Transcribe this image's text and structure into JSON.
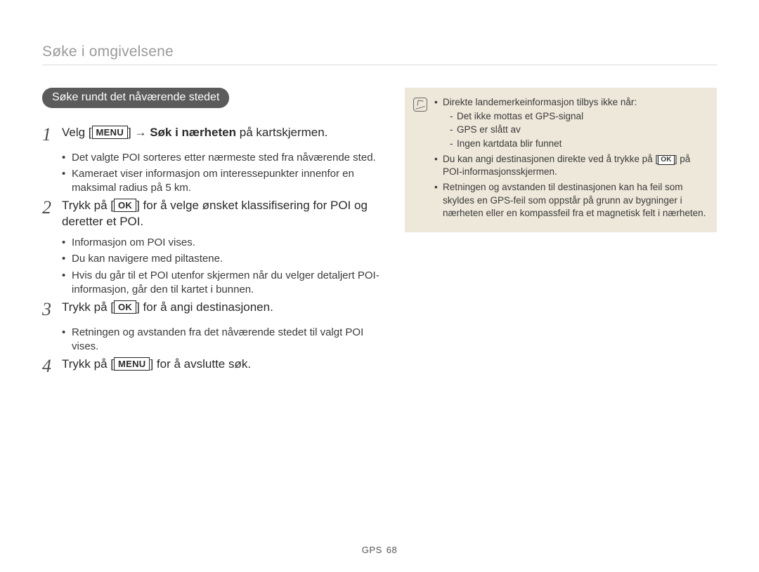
{
  "header": {
    "title": "Søke i omgivelsene"
  },
  "pill": {
    "label": "Søke rundt det nåværende stedet"
  },
  "buttons": {
    "menu": "MENU",
    "ok": "OK"
  },
  "steps": [
    {
      "num": "1",
      "parts": {
        "p1": "Velg [",
        "btn": "menu",
        "p2": "] → ",
        "bold": "Søk i nærheten",
        "p3": " på kartskjermen."
      },
      "bullets": [
        "Det valgte POI sorteres etter nærmeste sted fra nåværende sted.",
        "Kameraet viser informasjon om interessepunkter innenfor en maksimal radius på 5 km."
      ]
    },
    {
      "num": "2",
      "parts": {
        "p1": "Trykk på [",
        "btn": "ok",
        "p2": "] for å velge ønsket klassifisering for POI og deretter et POI."
      },
      "bullets": [
        "Informasjon om POI vises.",
        "Du kan navigere med piltastene.",
        "Hvis du går til et POI utenfor skjermen når du velger detaljert POI-informasjon, går den til kartet i bunnen."
      ]
    },
    {
      "num": "3",
      "parts": {
        "p1": "Trykk på [",
        "btn": "ok",
        "p2": "] for å angi destinasjonen."
      },
      "bullets": [
        "Retningen og avstanden fra det nåværende stedet til valgt POI vises."
      ]
    },
    {
      "num": "4",
      "parts": {
        "p1": "Trykk på [",
        "btn": "menu",
        "p2": "] for å avslutte søk."
      },
      "bullets": []
    }
  ],
  "note": {
    "items": [
      {
        "text": "Direkte landemerkeinformasjon tilbys ikke når:",
        "sub": [
          "Det ikke mottas et GPS-signal",
          "GPS er slått av",
          "Ingen kartdata blir funnet"
        ]
      },
      {
        "parts": {
          "p1": "Du kan angi destinasjonen direkte ved å trykke på [",
          "btn": "ok",
          "p2": "] på POI-informasjonsskjermen."
        }
      },
      {
        "text": "Retningen og avstanden til destinasjonen kan ha feil som skyldes en GPS-feil som oppstår på grunn av bygninger i nærheten eller en kompassfeil fra et magnetisk felt i nærheten."
      }
    ]
  },
  "footer": {
    "section": "GPS",
    "page": "68"
  }
}
